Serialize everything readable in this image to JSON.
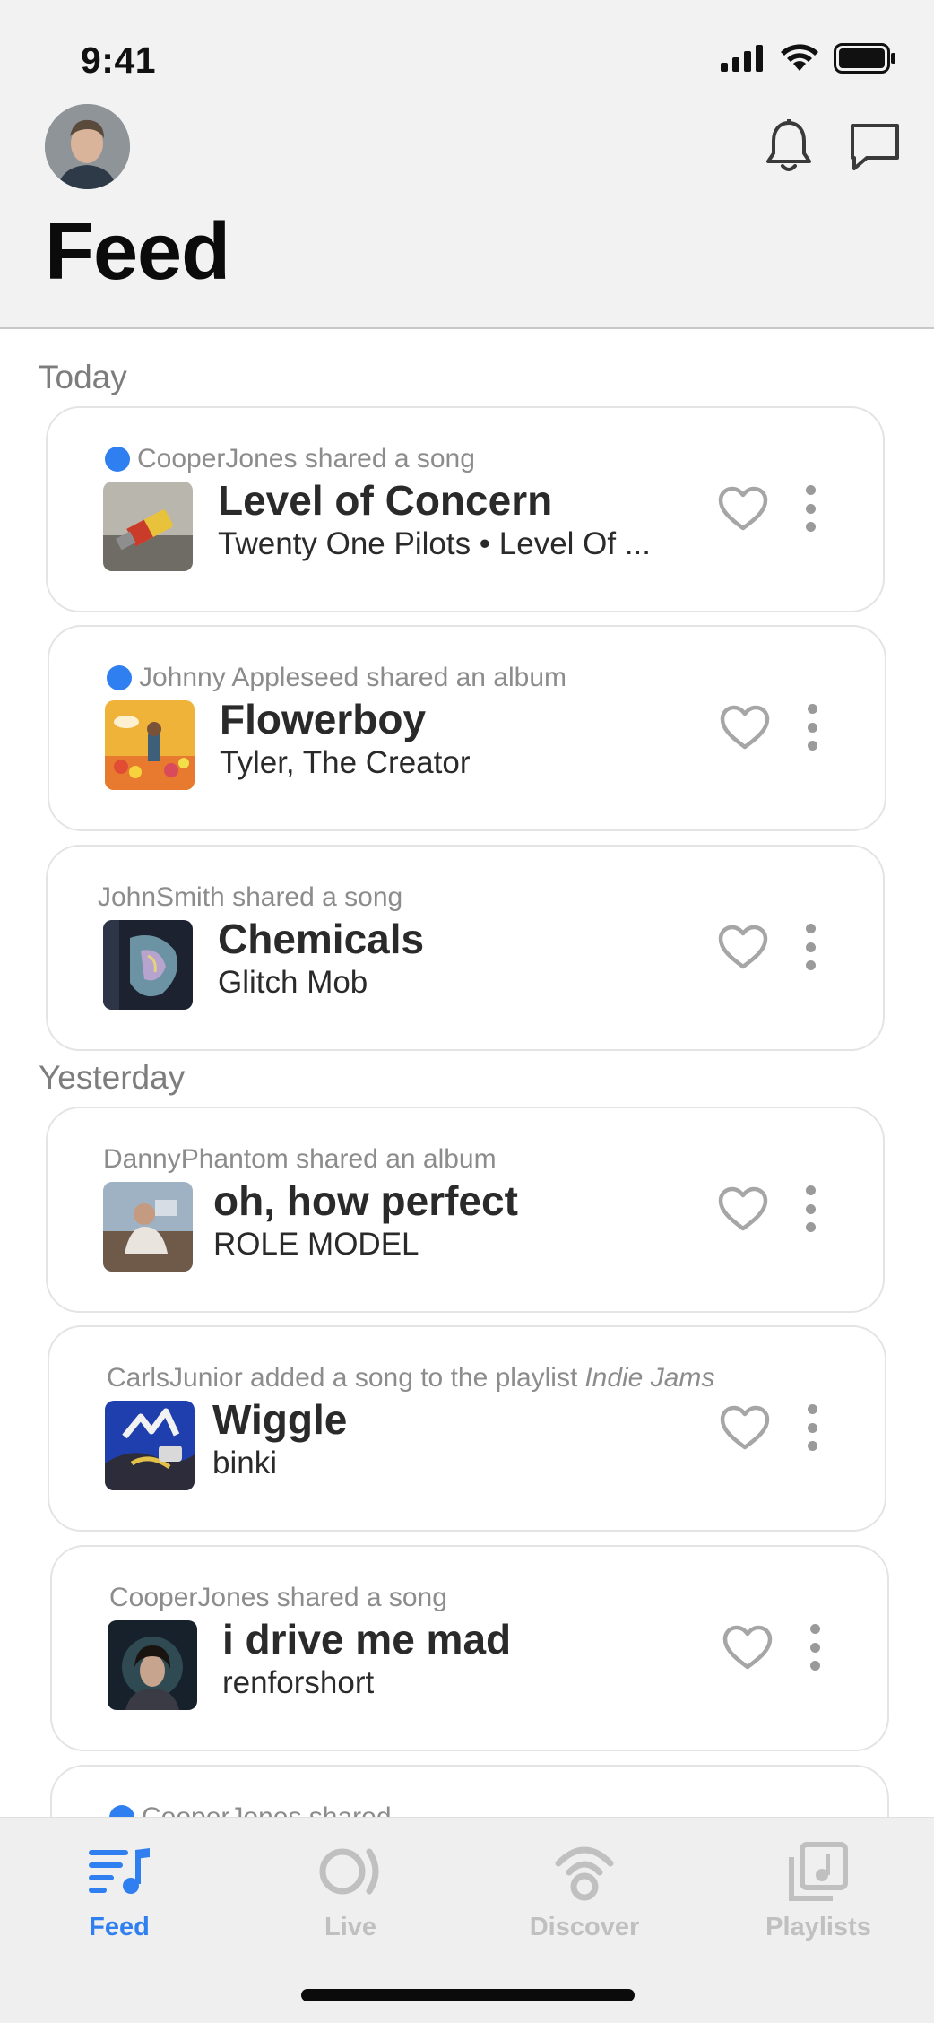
{
  "status_bar": {
    "time": "9:41"
  },
  "header": {
    "title": "Feed"
  },
  "sections": [
    {
      "label": "Today"
    },
    {
      "label": "Yesterday"
    }
  ],
  "cards": [
    {
      "meta": "CooperJones shared a song",
      "unread": true,
      "title": "Level of Concern",
      "subtitle": "Twenty One Pilots • Level Of ..."
    },
    {
      "meta": "Johnny Appleseed shared an album",
      "unread": true,
      "title": "Flowerboy",
      "subtitle": "Tyler, The Creator"
    },
    {
      "meta": "JohnSmith shared a song",
      "unread": false,
      "title": "Chemicals",
      "subtitle": "Glitch Mob"
    },
    {
      "meta": "DannyPhantom shared an album",
      "unread": false,
      "title": "oh, how perfect",
      "subtitle": "ROLE MODEL"
    },
    {
      "meta": "CarlsJunior added a song to the playlist",
      "meta_playlist": "Indie Jams",
      "unread": false,
      "title": "Wiggle",
      "subtitle": "binki"
    },
    {
      "meta": "CooperJones shared a song",
      "unread": false,
      "title": "i drive me mad",
      "subtitle": "renforshort"
    },
    {
      "meta": "CooperJones shared",
      "unread": true,
      "title": "",
      "subtitle": ""
    }
  ],
  "tabs": [
    {
      "label": "Feed",
      "icon": "feed-icon",
      "active": true
    },
    {
      "label": "Live",
      "icon": "live-icon",
      "active": false
    },
    {
      "label": "Discover",
      "icon": "discover-icon",
      "active": false
    },
    {
      "label": "Playlists",
      "icon": "playlists-icon",
      "active": false
    }
  ],
  "colors": {
    "accent": "#2f7ff0",
    "inactive_tab": "#c0c0c0",
    "header_bg": "#f2f2f2"
  }
}
